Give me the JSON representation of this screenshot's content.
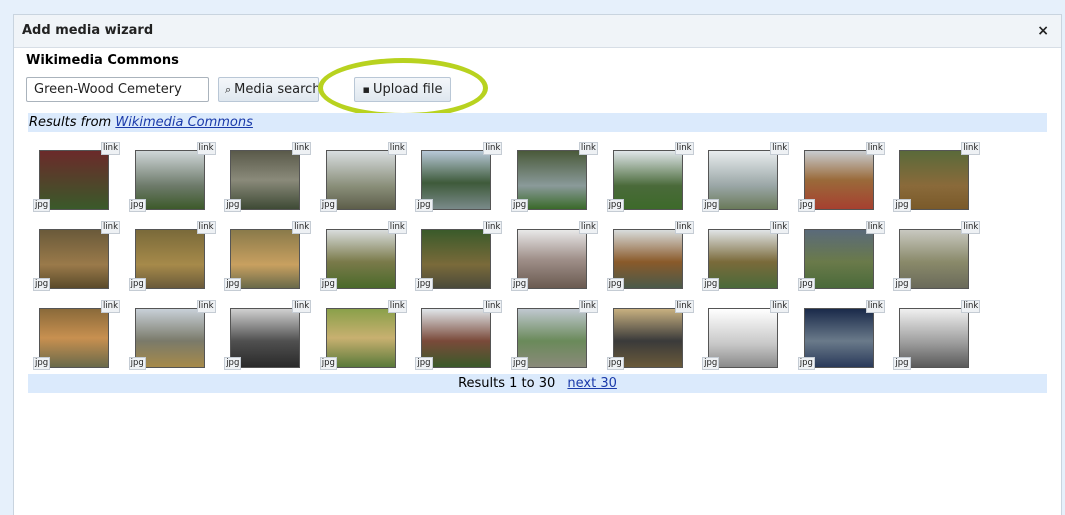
{
  "dialog": {
    "title": "Add media wizard",
    "close_label": "×"
  },
  "section_title": "Wikimedia Commons",
  "search": {
    "value": "Green-Wood Cemetery",
    "button_label": "Media search"
  },
  "upload_button_label": "Upload file",
  "results": {
    "prefix": "Results from",
    "source_link": "Wikimedia Commons",
    "range_text": "Results 1 to 30",
    "next_link": "next 30"
  },
  "accent_colors": {
    "highlight_ring": "#b8d21f",
    "info_bar": "#dbeafc"
  },
  "thumbnails": [
    {
      "link_label": "link",
      "type_label": "jpg",
      "bg": "linear-gradient(#6b2a2a,#3a5a2a)"
    },
    {
      "link_label": "link",
      "type_label": "jpg",
      "bg": "linear-gradient(#cfd6d8,#6d7a6a 60%,#3d5a2a)"
    },
    {
      "link_label": "link",
      "type_label": "jpg",
      "bg": "linear-gradient(#5a5a4a,#8a8a7a 50%,#3e4a35)"
    },
    {
      "link_label": "link",
      "type_label": "jpg",
      "bg": "linear-gradient(#d8dde0,#8a8f7a 60%,#5d5e4a)"
    },
    {
      "link_label": "link",
      "type_label": "jpg",
      "bg": "linear-gradient(#b8c8d8,#3e5a3a 55%,#7a8a8a)"
    },
    {
      "link_label": "link",
      "type_label": "jpg",
      "bg": "linear-gradient(#4a5a3a,#8a9a9a 60%,#3a6a2a)"
    },
    {
      "link_label": "link",
      "type_label": "jpg",
      "bg": "linear-gradient(#e0e6ea,#4a6a3a 60%,#3d6a2a)"
    },
    {
      "link_label": "link",
      "type_label": "jpg",
      "bg": "linear-gradient(#e8ecee,#9aa6a6 60%,#6a7a5a)"
    },
    {
      "link_label": "link",
      "type_label": "jpg",
      "bg": "linear-gradient(#c8ccd0,#9a6a3a 50%,#a64030)"
    },
    {
      "link_label": "link",
      "type_label": "jpg",
      "bg": "linear-gradient(#5a6a3a,#8a6a3a 60%,#7a5a2a)"
    },
    {
      "link_label": "link",
      "type_label": "jpg",
      "bg": "linear-gradient(#6a5a3a,#9a7a4a 60%,#5a4a2a)"
    },
    {
      "link_label": "link",
      "type_label": "jpg",
      "bg": "linear-gradient(#7a6a3a,#a68a4a 60%,#6a5a3a)"
    },
    {
      "link_label": "link",
      "type_label": "jpg",
      "bg": "linear-gradient(#8a7a4a,#c8a060 60%,#6a6a4a)"
    },
    {
      "link_label": "link",
      "type_label": "jpg",
      "bg": "linear-gradient(#d8dcdc,#7a7a4a 55%,#4a6a2a)"
    },
    {
      "link_label": "link",
      "type_label": "jpg",
      "bg": "linear-gradient(#3a5a2a,#7a6a3a 60%,#4a4a3a)"
    },
    {
      "link_label": "link",
      "type_label": "jpg",
      "bg": "linear-gradient(#e8e8e8,#a0908a 50%,#6a5a50)"
    },
    {
      "link_label": "link",
      "type_label": "jpg",
      "bg": "linear-gradient(#d8dcdc,#8a5a2a 55%,#4a5a4a)"
    },
    {
      "link_label": "link",
      "type_label": "jpg",
      "bg": "linear-gradient(#e0e4e6,#7a6a3a 55%,#4a6a3a)"
    },
    {
      "link_label": "link",
      "type_label": "jpg",
      "bg": "linear-gradient(#5a6a7a,#6a7a4a 55%,#4a6a3a)"
    },
    {
      "link_label": "link",
      "type_label": "jpg",
      "bg": "linear-gradient(#c8c8c0,#8a8a6a 55%,#6a6a5a)"
    },
    {
      "link_label": "link",
      "type_label": "jpg",
      "bg": "linear-gradient(#8a6a3a,#c89050 50%,#6a6a4a)"
    },
    {
      "link_label": "link",
      "type_label": "jpg",
      "bg": "linear-gradient(#c8d0d8,#7a7a6a 55%,#a68a4a)"
    },
    {
      "link_label": "link",
      "type_label": "jpg",
      "bg": "linear-gradient(#d0d0d0,#505050 55%,#2a2a2a)"
    },
    {
      "link_label": "link",
      "type_label": "jpg",
      "bg": "linear-gradient(#8aa04a,#c8b070 50%,#5a7a3a)"
    },
    {
      "link_label": "link",
      "type_label": "jpg",
      "bg": "linear-gradient(#e0e6ea,#7a4a3a 55%,#3a5a2a)"
    },
    {
      "link_label": "link",
      "type_label": "jpg",
      "bg": "linear-gradient(#c0c8d0,#6a8a5a 55%,#8a8a7a)"
    },
    {
      "link_label": "link",
      "type_label": "jpg",
      "bg": "linear-gradient(#c8b080,#3a3a3a 55%,#6a5a3a)"
    },
    {
      "link_label": "link",
      "type_label": "jpg",
      "bg": "linear-gradient(#ffffff,#c8c8c8 60%,#8a8a8a)"
    },
    {
      "link_label": "link",
      "type_label": "jpg",
      "bg": "linear-gradient(#1a2a4a,#6a7a8a 55%,#2a3a5a)"
    },
    {
      "link_label": "link",
      "type_label": "jpg",
      "bg": "linear-gradient(#f0f0f0,#9a9a9a 60%,#5a5a5a)"
    }
  ]
}
